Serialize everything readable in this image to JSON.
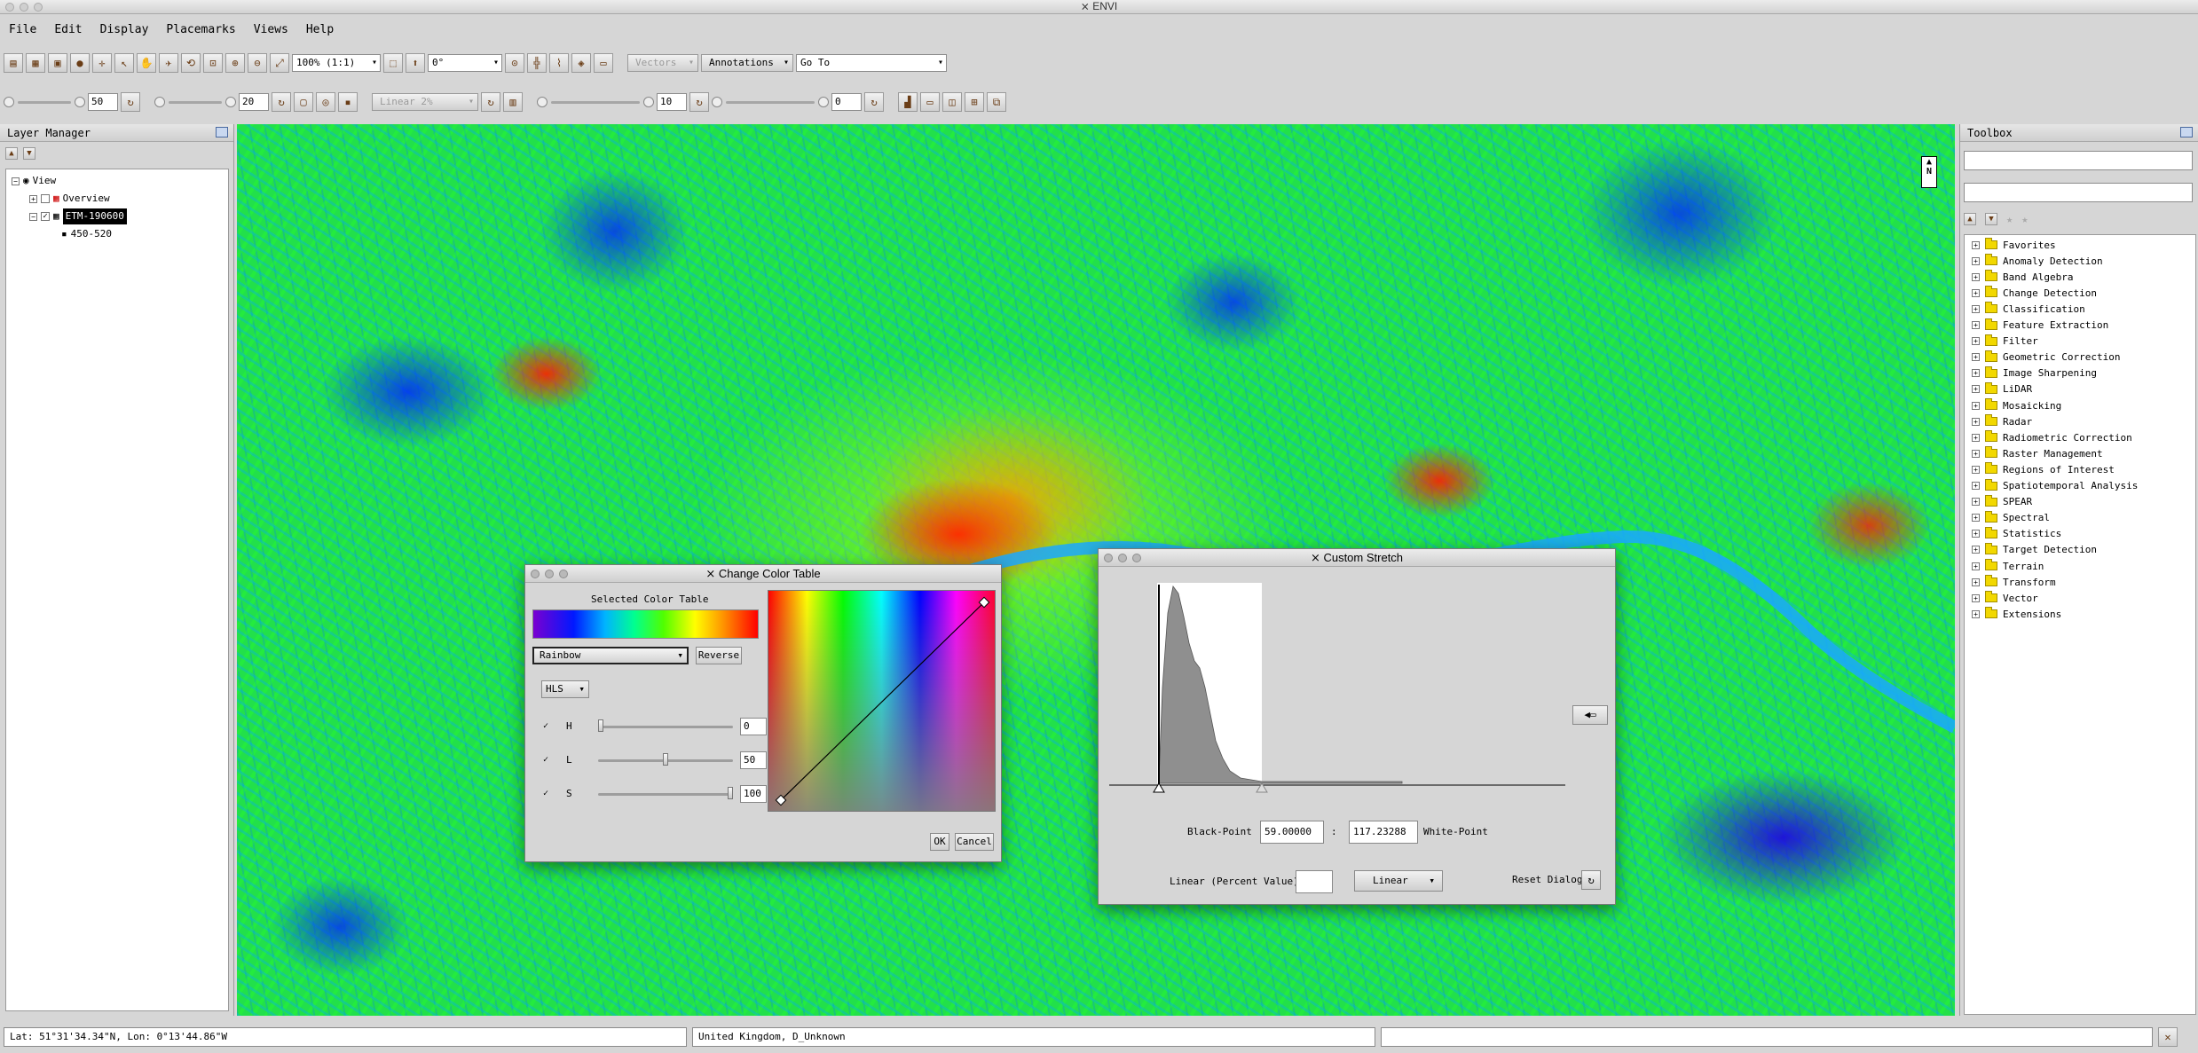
{
  "window": {
    "title": "ENVI"
  },
  "menu": [
    "File",
    "Edit",
    "Display",
    "Placemarks",
    "Views",
    "Help"
  ],
  "toolbar1": {
    "zoom_value": "100% (1:1)",
    "rotation_value": "0°",
    "vectors_label": "Vectors",
    "annotations_label": "Annotations",
    "goto_value": "Go To"
  },
  "toolbar2": {
    "brightness_value": "50",
    "contrast_value": "20",
    "stretch_value": "Linear 2%",
    "sharpen_value": "10",
    "transparency_value": "0"
  },
  "layer_manager": {
    "title": "Layer Manager",
    "tree": {
      "root": "View",
      "overview": "Overview",
      "layer": "ETM-190600",
      "band": "450-520"
    }
  },
  "toolbox": {
    "title": "Toolbox",
    "items": [
      "Favorites",
      "Anomaly Detection",
      "Band Algebra",
      "Change Detection",
      "Classification",
      "Feature Extraction",
      "Filter",
      "Geometric Correction",
      "Image Sharpening",
      "LiDAR",
      "Mosaicking",
      "Radar",
      "Radiometric Correction",
      "Raster Management",
      "Regions of Interest",
      "Spatiotemporal Analysis",
      "SPEAR",
      "Spectral",
      "Statistics",
      "Target Detection",
      "Terrain",
      "Transform",
      "Vector",
      "Extensions"
    ]
  },
  "map": {
    "north_label": "N"
  },
  "change_color_table": {
    "title": "Change Color Table",
    "selected_label": "Selected Color Table",
    "table_name": "Rainbow",
    "reverse_label": "Reverse",
    "mode": "HLS",
    "channels": [
      {
        "label": "H",
        "value": "0",
        "level": 0.0
      },
      {
        "label": "L",
        "value": "50",
        "level": 0.5
      },
      {
        "label": "S",
        "value": "100",
        "level": 1.0
      }
    ],
    "ok_label": "OK",
    "cancel_label": "Cancel"
  },
  "custom_stretch": {
    "title": "Custom Stretch",
    "black_point_label": "Black-Point",
    "black_point_value": "59.00000",
    "separator": ":",
    "white_point_value": "117.23288",
    "white_point_label": "White-Point",
    "percent_label": "Linear (Percent Value)",
    "percent_value": "",
    "stretch_type": "Linear",
    "reset_label": "Reset Dialog"
  },
  "statusbar": {
    "coords": "Lat: 51°31'34.34\"N, Lon: 0°13'44.86\"W",
    "projection": "United Kingdom, D_Unknown",
    "info": ""
  }
}
